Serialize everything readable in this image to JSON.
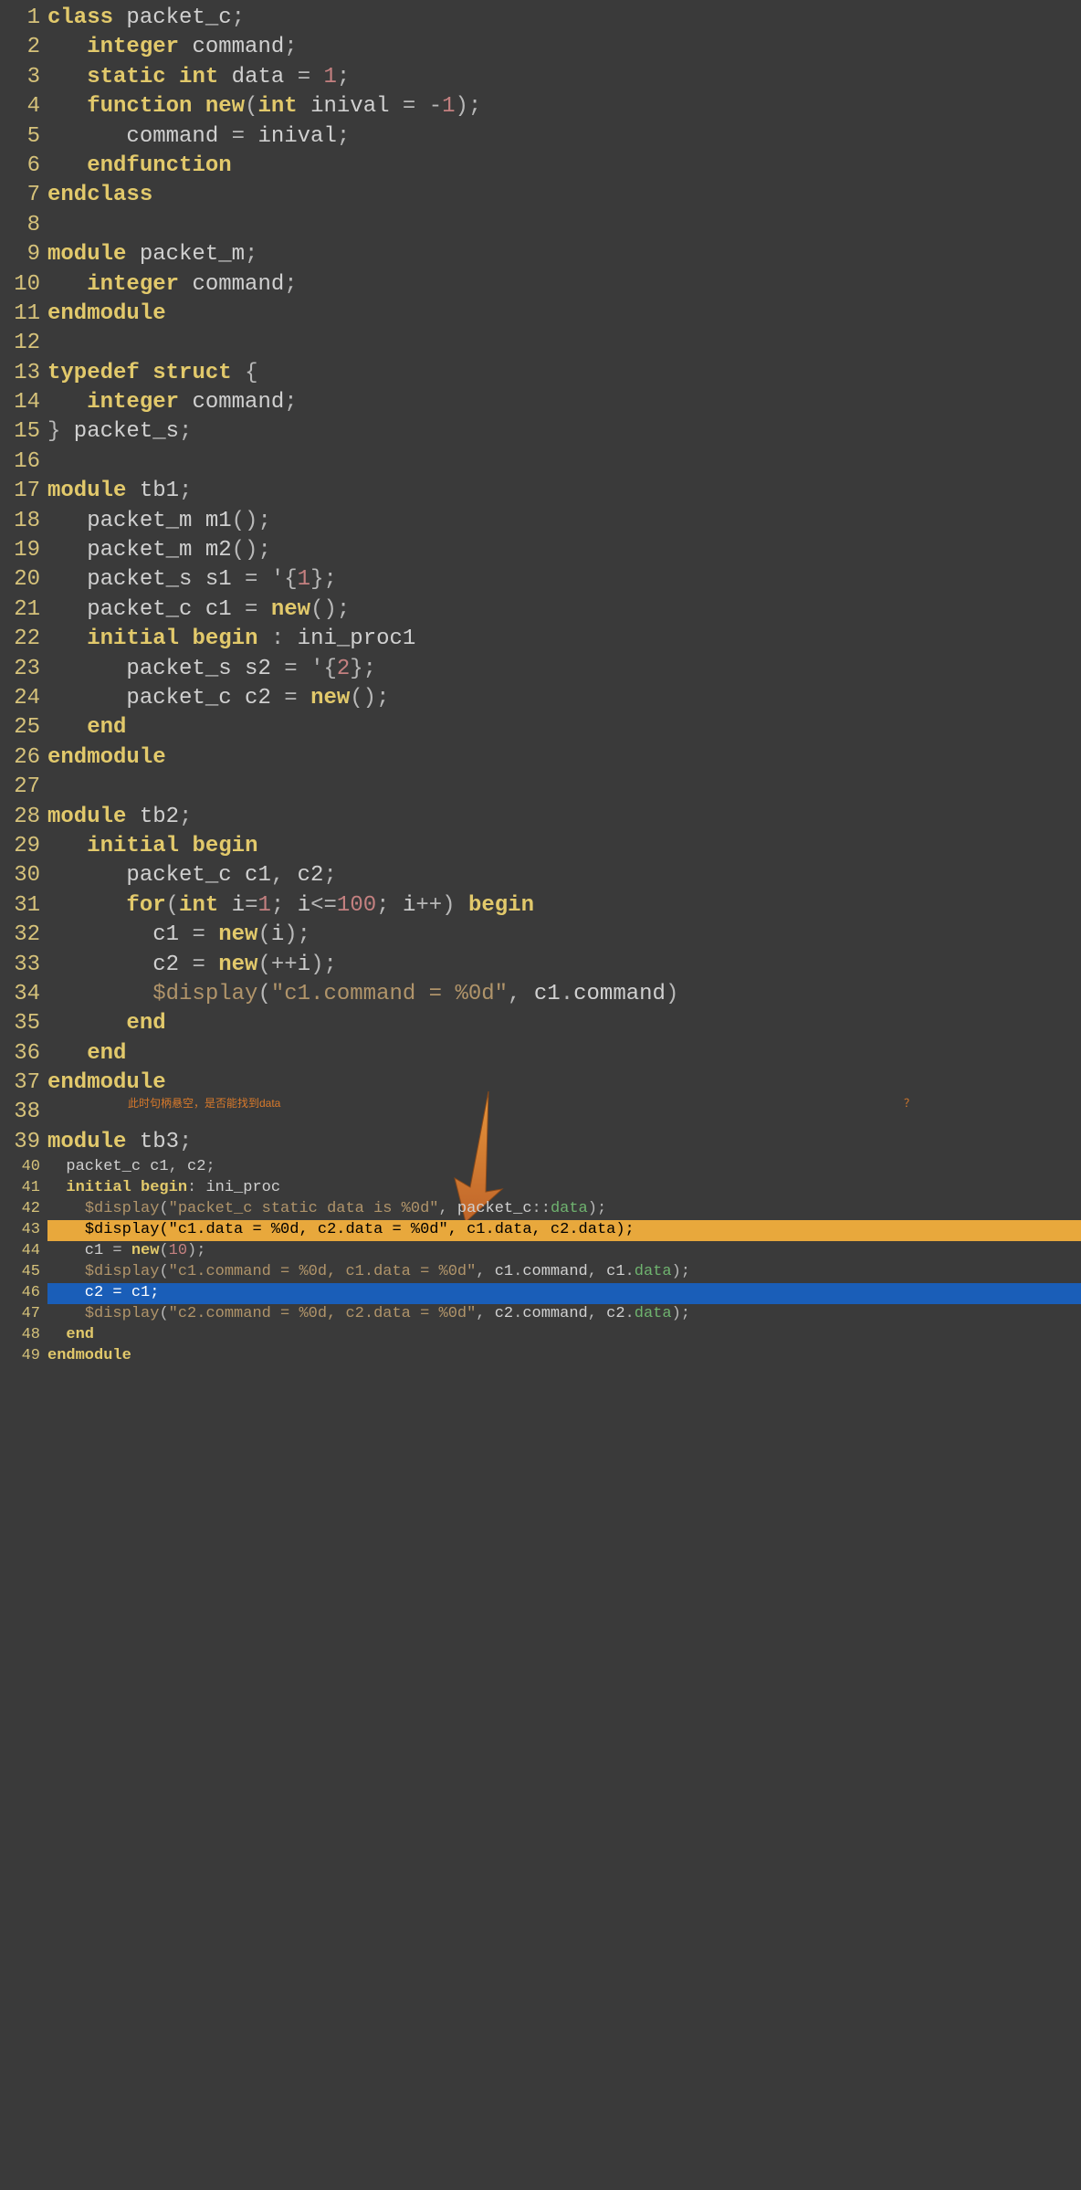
{
  "annotation_left": "此时句柄悬空，是否能找到data",
  "annotation_right": "？",
  "lines": [
    {
      "n": 1,
      "tokens": [
        [
          "kw",
          "class"
        ],
        [
          "id",
          " packet_c"
        ],
        [
          "pun",
          ";"
        ]
      ]
    },
    {
      "n": 2,
      "tokens": [
        [
          "id",
          "   "
        ],
        [
          "kw",
          "integer"
        ],
        [
          "id",
          " command"
        ],
        [
          "pun",
          ";"
        ]
      ]
    },
    {
      "n": 3,
      "tokens": [
        [
          "id",
          "   "
        ],
        [
          "kw",
          "static"
        ],
        [
          "id",
          " "
        ],
        [
          "kw",
          "int"
        ],
        [
          "id",
          " data "
        ],
        [
          "pun",
          "="
        ],
        [
          "id",
          " "
        ],
        [
          "num",
          "1"
        ],
        [
          "pun",
          ";"
        ]
      ]
    },
    {
      "n": 4,
      "tokens": [
        [
          "id",
          "   "
        ],
        [
          "kw",
          "function"
        ],
        [
          "id",
          " "
        ],
        [
          "kw",
          "new"
        ],
        [
          "pun",
          "("
        ],
        [
          "kw",
          "int"
        ],
        [
          "id",
          " inival "
        ],
        [
          "pun",
          "="
        ],
        [
          "id",
          " "
        ],
        [
          "pun",
          "-"
        ],
        [
          "num",
          "1"
        ],
        [
          "pun",
          ");"
        ]
      ]
    },
    {
      "n": 5,
      "tokens": [
        [
          "id",
          "      command "
        ],
        [
          "pun",
          "="
        ],
        [
          "id",
          " inival"
        ],
        [
          "pun",
          ";"
        ]
      ]
    },
    {
      "n": 6,
      "tokens": [
        [
          "id",
          "   "
        ],
        [
          "kw",
          "endfunction"
        ]
      ]
    },
    {
      "n": 7,
      "tokens": [
        [
          "kw",
          "endclass"
        ]
      ]
    },
    {
      "n": 8,
      "tokens": [
        [
          "id",
          ""
        ]
      ]
    },
    {
      "n": 9,
      "tokens": [
        [
          "kw",
          "module"
        ],
        [
          "id",
          " packet_m"
        ],
        [
          "pun",
          ";"
        ]
      ]
    },
    {
      "n": 10,
      "tokens": [
        [
          "id",
          "   "
        ],
        [
          "kw",
          "integer"
        ],
        [
          "id",
          " command"
        ],
        [
          "pun",
          ";"
        ]
      ]
    },
    {
      "n": 11,
      "tokens": [
        [
          "kw",
          "endmodule"
        ]
      ]
    },
    {
      "n": 12,
      "tokens": [
        [
          "id",
          ""
        ]
      ]
    },
    {
      "n": 13,
      "tokens": [
        [
          "kw",
          "typedef"
        ],
        [
          "id",
          " "
        ],
        [
          "kw",
          "struct"
        ],
        [
          "id",
          " "
        ],
        [
          "pun",
          "{"
        ]
      ]
    },
    {
      "n": 14,
      "tokens": [
        [
          "id",
          "   "
        ],
        [
          "kw",
          "integer"
        ],
        [
          "id",
          " command"
        ],
        [
          "pun",
          ";"
        ]
      ]
    },
    {
      "n": 15,
      "tokens": [
        [
          "pun",
          "}"
        ],
        [
          "id",
          " packet_s"
        ],
        [
          "pun",
          ";"
        ]
      ]
    },
    {
      "n": 16,
      "tokens": [
        [
          "id",
          ""
        ]
      ]
    },
    {
      "n": 17,
      "tokens": [
        [
          "kw",
          "module"
        ],
        [
          "id",
          " tb1"
        ],
        [
          "pun",
          ";"
        ]
      ]
    },
    {
      "n": 18,
      "tokens": [
        [
          "id",
          "   packet_m m1"
        ],
        [
          "pun",
          "();"
        ]
      ]
    },
    {
      "n": 19,
      "tokens": [
        [
          "id",
          "   packet_m m2"
        ],
        [
          "pun",
          "();"
        ]
      ]
    },
    {
      "n": 20,
      "tokens": [
        [
          "id",
          "   packet_s s1 "
        ],
        [
          "pun",
          "="
        ],
        [
          "id",
          " "
        ],
        [
          "pun",
          "'{"
        ],
        [
          "num",
          "1"
        ],
        [
          "pun",
          "};"
        ]
      ]
    },
    {
      "n": 21,
      "tokens": [
        [
          "id",
          "   packet_c c1 "
        ],
        [
          "pun",
          "="
        ],
        [
          "id",
          " "
        ],
        [
          "kw",
          "new"
        ],
        [
          "pun",
          "();"
        ]
      ]
    },
    {
      "n": 22,
      "tokens": [
        [
          "id",
          "   "
        ],
        [
          "kw",
          "initial"
        ],
        [
          "id",
          " "
        ],
        [
          "kw",
          "begin"
        ],
        [
          "id",
          " "
        ],
        [
          "pun",
          ":"
        ],
        [
          "id",
          " ini_proc1"
        ]
      ]
    },
    {
      "n": 23,
      "tokens": [
        [
          "id",
          "      packet_s s2 "
        ],
        [
          "pun",
          "="
        ],
        [
          "id",
          " "
        ],
        [
          "pun",
          "'{"
        ],
        [
          "num",
          "2"
        ],
        [
          "pun",
          "};"
        ]
      ]
    },
    {
      "n": 24,
      "tokens": [
        [
          "id",
          "      packet_c c2 "
        ],
        [
          "pun",
          "="
        ],
        [
          "id",
          " "
        ],
        [
          "kw",
          "new"
        ],
        [
          "pun",
          "();"
        ]
      ]
    },
    {
      "n": 25,
      "tokens": [
        [
          "id",
          "   "
        ],
        [
          "kw",
          "end"
        ]
      ]
    },
    {
      "n": 26,
      "tokens": [
        [
          "kw",
          "endmodule"
        ]
      ]
    },
    {
      "n": 27,
      "tokens": [
        [
          "id",
          ""
        ]
      ]
    },
    {
      "n": 28,
      "tokens": [
        [
          "kw",
          "module"
        ],
        [
          "id",
          " tb2"
        ],
        [
          "pun",
          ";"
        ]
      ]
    },
    {
      "n": 29,
      "tokens": [
        [
          "id",
          "   "
        ],
        [
          "kw",
          "initial"
        ],
        [
          "id",
          " "
        ],
        [
          "kw",
          "begin"
        ]
      ]
    },
    {
      "n": 30,
      "tokens": [
        [
          "id",
          "      packet_c c1"
        ],
        [
          "pun",
          ","
        ],
        [
          "id",
          " c2"
        ],
        [
          "pun",
          ";"
        ]
      ]
    },
    {
      "n": 31,
      "tokens": [
        [
          "id",
          "      "
        ],
        [
          "kw",
          "for"
        ],
        [
          "pun",
          "("
        ],
        [
          "kw",
          "int"
        ],
        [
          "id",
          " i"
        ],
        [
          "pun",
          "="
        ],
        [
          "num",
          "1"
        ],
        [
          "pun",
          ";"
        ],
        [
          "id",
          " i"
        ],
        [
          "pun",
          "<="
        ],
        [
          "num",
          "100"
        ],
        [
          "pun",
          ";"
        ],
        [
          "id",
          " i"
        ],
        [
          "pun",
          "++) "
        ],
        [
          "kw",
          "begin"
        ]
      ]
    },
    {
      "n": 32,
      "tokens": [
        [
          "id",
          "        c1 "
        ],
        [
          "pun",
          "="
        ],
        [
          "id",
          " "
        ],
        [
          "kw",
          "new"
        ],
        [
          "pun",
          "("
        ],
        [
          "id",
          "i"
        ],
        [
          "pun",
          ");"
        ]
      ]
    },
    {
      "n": 33,
      "tokens": [
        [
          "id",
          "        c2 "
        ],
        [
          "pun",
          "="
        ],
        [
          "id",
          " "
        ],
        [
          "kw",
          "new"
        ],
        [
          "pun",
          "(++"
        ],
        [
          "id",
          "i"
        ],
        [
          "pun",
          ");"
        ]
      ]
    },
    {
      "n": 34,
      "tokens": [
        [
          "id",
          "        "
        ],
        [
          "sys",
          "$display"
        ],
        [
          "pun",
          "("
        ],
        [
          "str",
          "\"c1.command = %0d\""
        ],
        [
          "pun",
          ","
        ],
        [
          "id",
          " c1"
        ],
        [
          "pun",
          "."
        ],
        [
          "id",
          "command"
        ],
        [
          "pun",
          ")"
        ]
      ]
    },
    {
      "n": 35,
      "tokens": [
        [
          "id",
          "      "
        ],
        [
          "kw",
          "end"
        ]
      ]
    },
    {
      "n": 36,
      "tokens": [
        [
          "id",
          "   "
        ],
        [
          "kw",
          "end"
        ]
      ]
    },
    {
      "n": 37,
      "tokens": [
        [
          "kw",
          "endmodule"
        ]
      ]
    },
    {
      "n": 38,
      "tokens": [
        [
          "id",
          ""
        ]
      ]
    },
    {
      "n": 39,
      "tokens": [
        [
          "kw",
          "module"
        ],
        [
          "id",
          " tb3"
        ],
        [
          "pun",
          ";"
        ]
      ]
    },
    {
      "n": 40,
      "small": true,
      "tokens": [
        [
          "id",
          "  packet_c c1"
        ],
        [
          "pun",
          ","
        ],
        [
          "id",
          " c2"
        ],
        [
          "pun",
          ";"
        ]
      ]
    },
    {
      "n": 41,
      "small": true,
      "tokens": [
        [
          "id",
          "  "
        ],
        [
          "kw",
          "initial"
        ],
        [
          "id",
          " "
        ],
        [
          "kw",
          "begin"
        ],
        [
          "pun",
          ":"
        ],
        [
          "id",
          " ini_proc"
        ]
      ]
    },
    {
      "n": 42,
      "small": true,
      "tokens": [
        [
          "id",
          "    "
        ],
        [
          "sys",
          "$display"
        ],
        [
          "pun",
          "("
        ],
        [
          "str",
          "\"packet_c static data is %0d\""
        ],
        [
          "pun",
          ","
        ],
        [
          "id",
          " packet_c"
        ],
        [
          "pun",
          "::"
        ],
        [
          "green",
          "data"
        ],
        [
          "pun",
          ");"
        ]
      ]
    },
    {
      "n": 43,
      "small": true,
      "hl": "yellow",
      "tokens": [
        [
          "id",
          "    "
        ],
        [
          "sys",
          "$display"
        ],
        [
          "pun",
          "("
        ],
        [
          "str",
          "\"c1.data = %0d, c2.data = %0d\""
        ],
        [
          "pun",
          ","
        ],
        [
          "id",
          " c1"
        ],
        [
          "pun",
          "."
        ],
        [
          "id",
          "data"
        ],
        [
          "pun",
          ","
        ],
        [
          "id",
          " c2"
        ],
        [
          "pun",
          "."
        ],
        [
          "id",
          "data"
        ],
        [
          "pun",
          ");"
        ]
      ]
    },
    {
      "n": 44,
      "small": true,
      "tokens": [
        [
          "id",
          "    c1 "
        ],
        [
          "pun",
          "="
        ],
        [
          "id",
          " "
        ],
        [
          "kw",
          "new"
        ],
        [
          "pun",
          "("
        ],
        [
          "num",
          "10"
        ],
        [
          "pun",
          ");"
        ]
      ]
    },
    {
      "n": 45,
      "small": true,
      "tokens": [
        [
          "id",
          "    "
        ],
        [
          "sys",
          "$display"
        ],
        [
          "pun",
          "("
        ],
        [
          "str",
          "\"c1.command = %0d, c1.data = %0d\""
        ],
        [
          "pun",
          ","
        ],
        [
          "id",
          " c1"
        ],
        [
          "pun",
          "."
        ],
        [
          "id",
          "command"
        ],
        [
          "pun",
          ","
        ],
        [
          "id",
          " c1"
        ],
        [
          "pun",
          "."
        ],
        [
          "green",
          "data"
        ],
        [
          "pun",
          ");"
        ]
      ]
    },
    {
      "n": 46,
      "small": true,
      "hl": "blue",
      "tokens": [
        [
          "id",
          "    c2 "
        ],
        [
          "pun",
          "="
        ],
        [
          "id",
          " c1"
        ],
        [
          "pun",
          ";"
        ]
      ]
    },
    {
      "n": 47,
      "small": true,
      "tokens": [
        [
          "id",
          "    "
        ],
        [
          "sys",
          "$display"
        ],
        [
          "pun",
          "("
        ],
        [
          "str",
          "\"c2.command = %0d, c2.data = %0d\""
        ],
        [
          "pun",
          ","
        ],
        [
          "id",
          " c2"
        ],
        [
          "pun",
          "."
        ],
        [
          "id",
          "command"
        ],
        [
          "pun",
          ","
        ],
        [
          "id",
          " c2"
        ],
        [
          "pun",
          "."
        ],
        [
          "green",
          "data"
        ],
        [
          "pun",
          ");"
        ]
      ]
    },
    {
      "n": 48,
      "small": true,
      "tokens": [
        [
          "id",
          "  "
        ],
        [
          "kw",
          "end"
        ]
      ]
    },
    {
      "n": 49,
      "small": true,
      "tokens": [
        [
          "kw",
          "endmodule"
        ]
      ]
    }
  ]
}
